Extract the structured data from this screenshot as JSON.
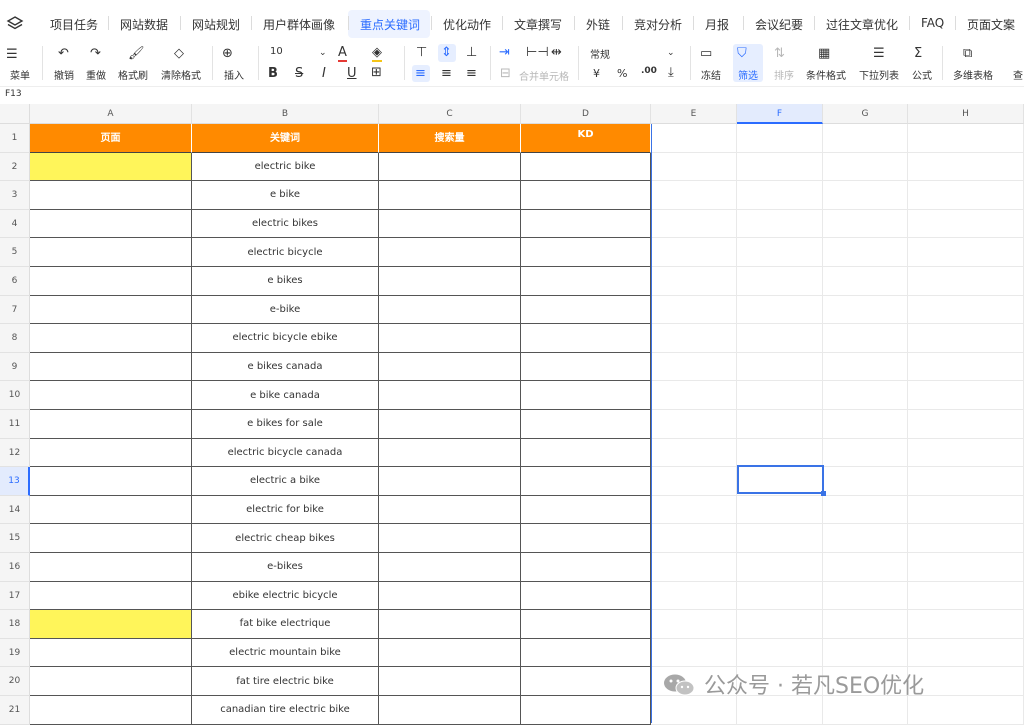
{
  "tabs": [
    "项目任务",
    "网站数据",
    "网站规划",
    "用户群体画像",
    "重点关键词",
    "优化动作",
    "文章撰写",
    "外链",
    "竞对分析",
    "月报",
    "会议纪要",
    "过往文章优化",
    "FAQ",
    "页面文案"
  ],
  "active_tab": "重点关键词",
  "toolbar": {
    "menu": "菜单",
    "undo": "撤销",
    "redo": "重做",
    "format_painter": "格式刷",
    "clear_format": "清除格式",
    "insert": "插入",
    "font_size": "10",
    "merge_cells": "合并单元格",
    "number_format": "常规",
    "currency": "¥",
    "percent": "%",
    "decimal": ".00",
    "freeze": "冻结",
    "filter": "筛选",
    "sort": "排序",
    "conditional_format": "条件格式",
    "dropdown_list": "下拉列表",
    "formula": "公式",
    "multi_dim_table": "多维表格",
    "cut_off": "查"
  },
  "cell_ref": "F13",
  "columns": [
    "A",
    "B",
    "C",
    "D",
    "E",
    "F",
    "G",
    "H"
  ],
  "selected_column": "F",
  "selected_row": "13",
  "header": {
    "page": "页面",
    "keyword": "关键词",
    "search_volume": "搜索量",
    "kd": "KD"
  },
  "rows": [
    {
      "num": "2",
      "keyword": "electric bike"
    },
    {
      "num": "3",
      "keyword": "e bike"
    },
    {
      "num": "4",
      "keyword": "electric bikes"
    },
    {
      "num": "5",
      "keyword": "electric bicycle"
    },
    {
      "num": "6",
      "keyword": "e bikes"
    },
    {
      "num": "7",
      "keyword": "e-bike"
    },
    {
      "num": "8",
      "keyword": "electric bicycle ebike"
    },
    {
      "num": "9",
      "keyword": "e bikes canada"
    },
    {
      "num": "10",
      "keyword": "e bike canada"
    },
    {
      "num": "11",
      "keyword": "e bikes for sale"
    },
    {
      "num": "12",
      "keyword": "electric bicycle canada"
    },
    {
      "num": "13",
      "keyword": "electric a bike"
    },
    {
      "num": "14",
      "keyword": "electric for bike"
    },
    {
      "num": "15",
      "keyword": "electric cheap bikes"
    },
    {
      "num": "16",
      "keyword": "e-bikes"
    },
    {
      "num": "17",
      "keyword": "ebike electric bicycle"
    },
    {
      "num": "18",
      "keyword": "fat bike electrique"
    },
    {
      "num": "19",
      "keyword": "electric mountain bike"
    },
    {
      "num": "20",
      "keyword": "fat tire electric bike"
    },
    {
      "num": "21",
      "keyword": "canadian tire electric bike"
    }
  ],
  "header_row_num": "1",
  "highlighted_rows": [
    "2",
    "18"
  ],
  "colors": {
    "header_orange": "#ff8a00",
    "highlight_yellow": "#fff55a",
    "accent_blue": "#2b6cff"
  },
  "watermark": "公众号 · 若凡SEO优化"
}
